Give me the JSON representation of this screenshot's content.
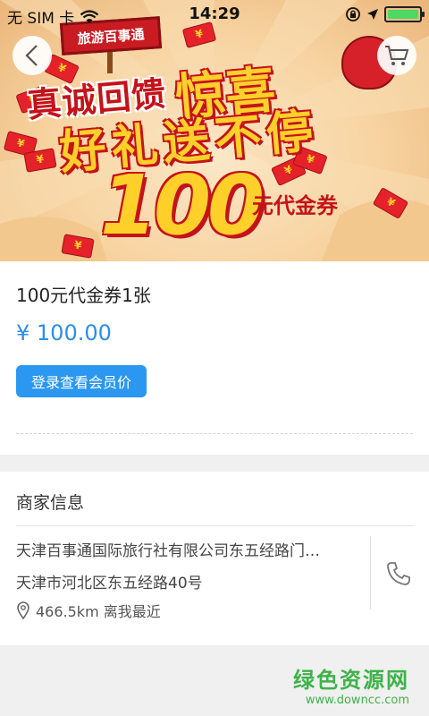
{
  "status_bar": {
    "carrier": "无 SIM 卡",
    "time": "14:29",
    "battery_level": 1.0
  },
  "banner": {
    "sign": "旅游百事通",
    "headline_1": "真诚回馈",
    "headline_2": "惊喜",
    "headline_3": "好礼送不停",
    "amount": "100",
    "coupon_label": "元代金券",
    "icons": {
      "back": "chevron-left-icon",
      "cart": "cart-icon"
    }
  },
  "product": {
    "title": "100元代金券1张",
    "price": "¥ 100.00",
    "member_button": "登录查看会员价",
    "colors": {
      "price": "#2b8fe6",
      "button": "#2b97f0"
    }
  },
  "merchant": {
    "section_title": "商家信息",
    "name": "天津百事通国际旅行社有限公司东五经路门…",
    "address": "天津市河北区东五经路40号",
    "distance": "466.5km 离我最近",
    "icons": {
      "location": "location-pin-icon",
      "phone": "phone-icon"
    }
  },
  "watermark": {
    "name": "绿色资源网",
    "url": "www.downcc.com"
  }
}
